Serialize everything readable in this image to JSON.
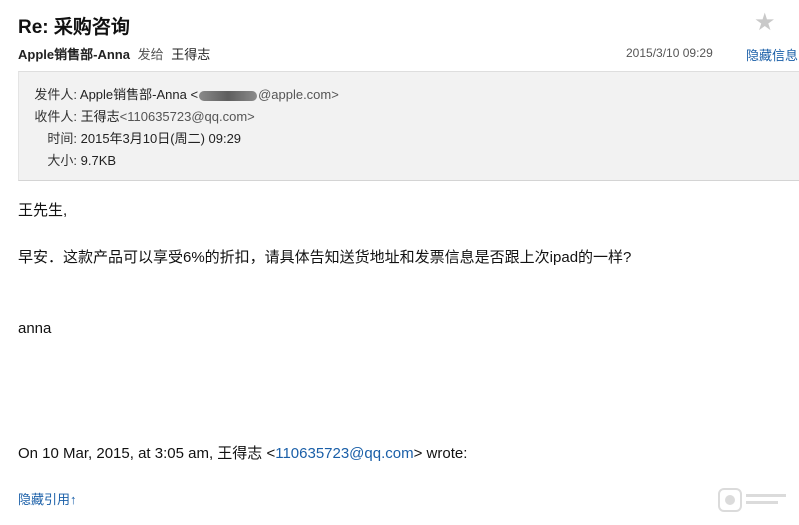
{
  "email": {
    "subject": "Re: 采购咨询",
    "star_icon": "star-icon",
    "sender_name": "Apple销售部-Anna",
    "sent_to_verb": "发给",
    "recipient_name": "王得志",
    "date_short": "2015/3/10  09:29",
    "hide_info_label": "隐藏信息"
  },
  "details": {
    "from_label": "发件人:",
    "from_name": "Apple销售部-Anna <",
    "from_domain": "@apple.com>",
    "to_label": "收件人:",
    "to_name": "王得志",
    "to_email": "<110635723@qq.com>",
    "time_label": "时间:",
    "time_value": "2015年3月10日(周二)  09:29",
    "size_label": "大小:",
    "size_value": "9.7KB",
    "background_color": "#f2f2f2"
  },
  "body": {
    "greeting": "王先生,",
    "paragraph": "早安．这款产品可以享受6%的折扣，请具体告知送货地址和发票信息是否跟上次ipad的一样?",
    "signature": "anna",
    "quote_prefix": "On 10 Mar, 2015, at 3:05 am, 王得志 <",
    "quote_email": "110635723@qq.com",
    "quote_suffix": "> wrote:",
    "hide_quote_label": "隐藏引用↑"
  },
  "colors": {
    "link": "#1a5fa8",
    "star": "#c9c9c9"
  }
}
